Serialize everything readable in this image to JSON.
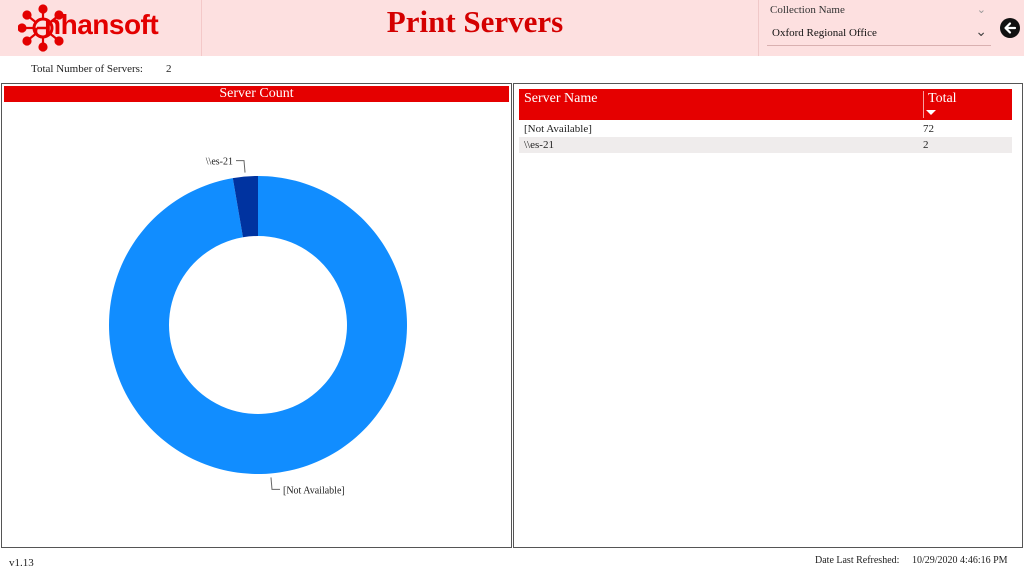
{
  "header": {
    "logo_text": "nhansoft",
    "title": "Print Servers",
    "filter": {
      "label": "Collection Name",
      "value": "Oxford Regional Office"
    }
  },
  "summary": {
    "total_label": "Total Number of Servers:",
    "total_value": "2"
  },
  "chart_panel": {
    "title": "Server Count"
  },
  "chart_data": {
    "type": "pie",
    "title": "Server Count",
    "donut": true,
    "categories": [
      "[Not Available]",
      "\\\\es-21"
    ],
    "values": [
      72,
      2
    ],
    "colors": [
      "#118dff",
      "#0033a0"
    ]
  },
  "table": {
    "columns": [
      "Server Name",
      "Total"
    ],
    "rows": [
      {
        "name": "[Not Available]",
        "total": "72"
      },
      {
        "name": "\\\\es-21",
        "total": "2"
      }
    ]
  },
  "footer": {
    "version": "v1.13",
    "refresh_label": "Date Last Refreshed:",
    "refresh_value": "10/29/2020 4:46:16 PM"
  },
  "colors": {
    "brand_red": "#e50000",
    "header_bg": "#fde0e0",
    "row_alt": "#efecec"
  },
  "icons": {
    "logo": "network-node-icon",
    "back": "arrow-left-icon",
    "dropdown": "chevron-down-icon",
    "sort": "sort-desc-icon"
  }
}
